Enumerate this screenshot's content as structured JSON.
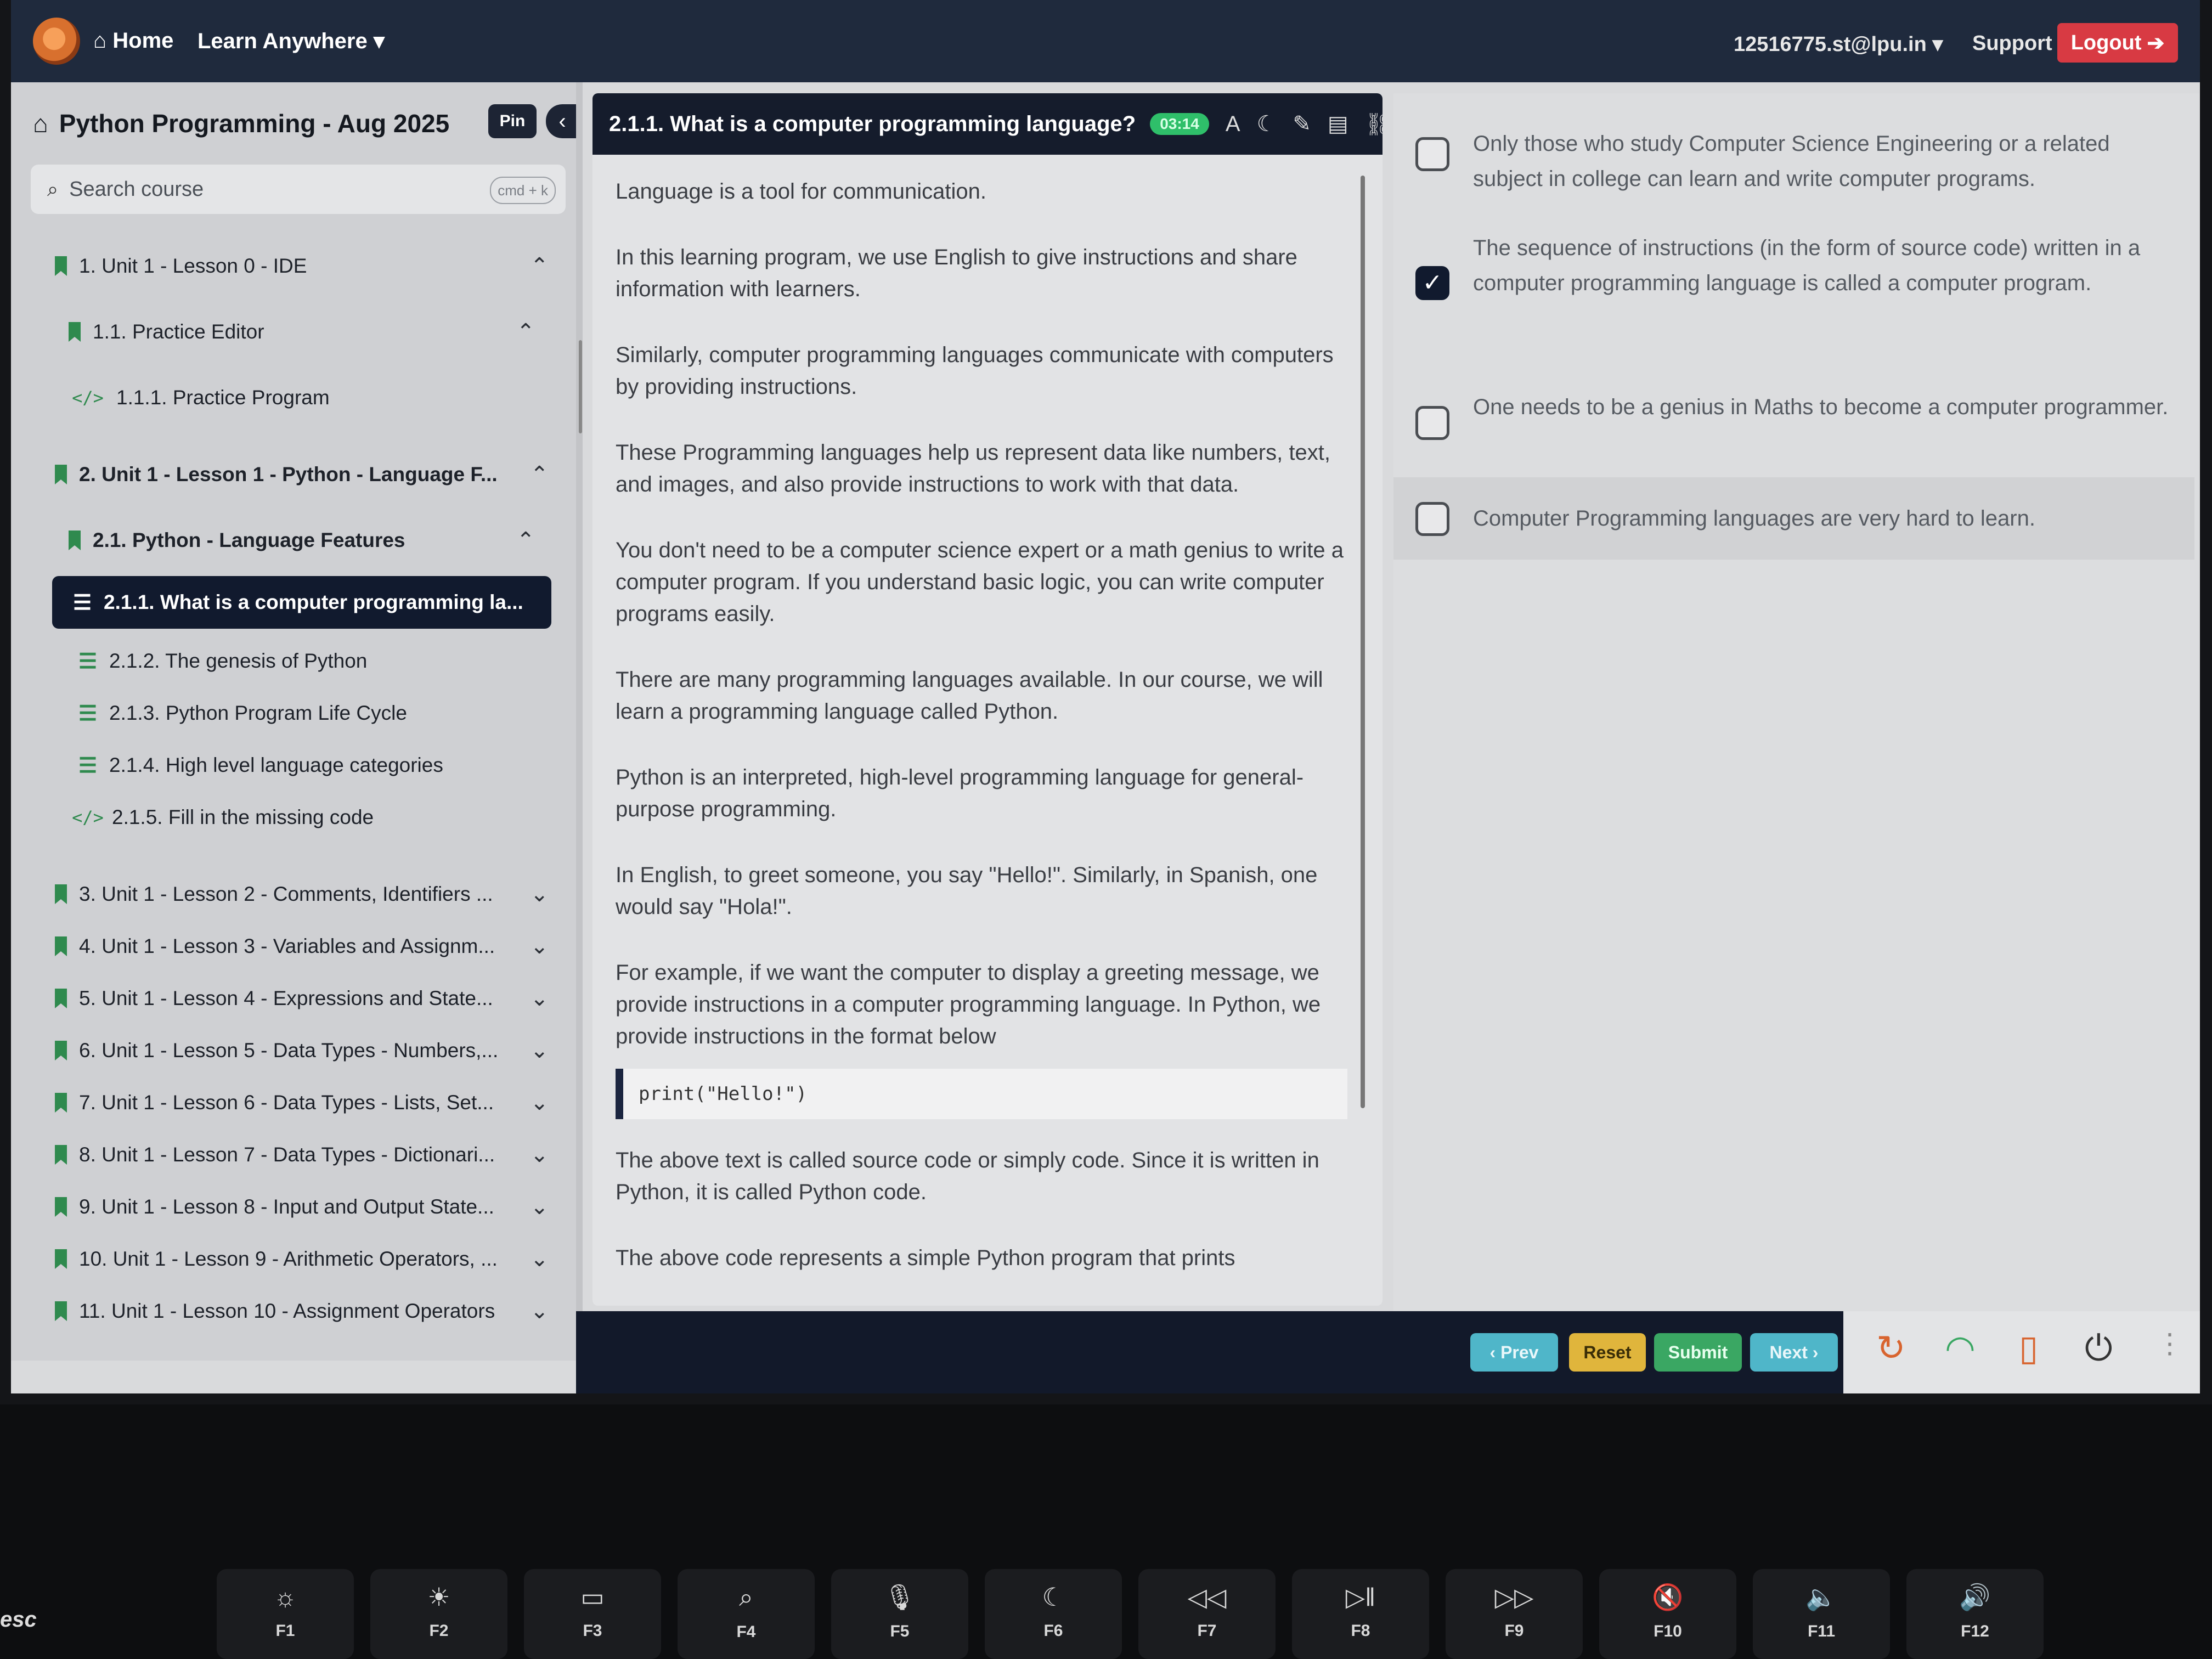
{
  "topnav": {
    "home_label": "Home",
    "learn_label": "Learn Anywhere",
    "user_label": "12516775.st@lpu.in",
    "support_label": "Support",
    "logout_label": "Logout"
  },
  "sidebar": {
    "course_title": "Python Programming - Aug 2025",
    "pin_label": "Pin",
    "search_placeholder": "Search course",
    "search_shortcut": "cmd + k",
    "items": [
      {
        "label": "1. Unit 1 - Lesson 0 - IDE"
      },
      {
        "label": "1.1. Practice Editor"
      },
      {
        "label": "1.1.1. Practice Program"
      },
      {
        "label": "2. Unit 1 - Lesson 1 - Python - Language F..."
      },
      {
        "label": "2.1. Python - Language Features"
      },
      {
        "label": "2.1.1. What is a computer programming la..."
      },
      {
        "label": "2.1.2. The genesis of Python"
      },
      {
        "label": "2.1.3. Python Program Life Cycle"
      },
      {
        "label": "2.1.4. High level language categories"
      },
      {
        "label": "2.1.5. Fill in the missing code"
      },
      {
        "label": "3. Unit 1 - Lesson 2 - Comments, Identifiers ..."
      },
      {
        "label": "4. Unit 1 - Lesson 3 - Variables and Assignm..."
      },
      {
        "label": "5. Unit 1 - Lesson 4 - Expressions and State..."
      },
      {
        "label": "6. Unit 1 - Lesson 5 - Data Types - Numbers,..."
      },
      {
        "label": "7. Unit 1 - Lesson 6 - Data Types - Lists, Set..."
      },
      {
        "label": "8. Unit 1 - Lesson 7 - Data Types - Dictionari..."
      },
      {
        "label": "9. Unit 1 - Lesson 8 - Input and Output State..."
      },
      {
        "label": "10. Unit 1 - Lesson 9 - Arithmetic Operators, ..."
      },
      {
        "label": "11. Unit 1 - Lesson 10 - Assignment Operators"
      }
    ]
  },
  "content": {
    "title": "2.1.1. What is a computer programming language?",
    "timer": "03:14",
    "paragraphs": [
      "Language is a tool for communication.",
      "In this learning program, we use English to give instructions and share information with learners.",
      "Similarly, computer programming languages communicate with computers by providing instructions.",
      "These Programming languages help us represent data like numbers, text, and images, and also provide instructions to work with that data.",
      "You don't need to be a computer science expert or a math genius to write a computer program. If you understand basic logic, you can write computer programs easily.",
      "There are many programming languages available. In our course, we will learn a programming language called Python.",
      "Python is an interpreted, high-level programming language for general-purpose programming.",
      "In English, to greet someone, you say \"Hello!\". Similarly, in Spanish, one would say \"Hola!\".",
      "For example, if we want the computer to display a greeting message, we provide instructions in a computer programming language. In Python, we provide instructions in the format below"
    ],
    "code": "print(\"Hello!\")",
    "after_code": [
      "The above text is called source code or simply code. Since it is written in Python, it is called Python code.",
      "The above code represents a simple Python program that prints"
    ]
  },
  "answers": {
    "options": [
      {
        "text": "Only those who study Computer Science Engineering or a related subject in college can learn and write computer programs.",
        "checked": false
      },
      {
        "text": "The sequence of instructions (in the form of source code) written in a computer programming language is called a computer program.",
        "checked": true
      },
      {
        "text": "One needs to be a genius in Maths to become a computer programmer.",
        "checked": false
      },
      {
        "text": "Computer Programming languages are very hard to learn.",
        "checked": false
      }
    ]
  },
  "bottom": {
    "prev_label": "‹ Prev",
    "reset_label": "Reset",
    "submit_label": "Submit",
    "next_label": "Next ›"
  },
  "keyboard": {
    "esc": "esc",
    "keys": [
      "F1",
      "F2",
      "F3",
      "F4",
      "F5",
      "F6",
      "F7",
      "F8",
      "F9",
      "F10",
      "F11",
      "F12"
    ]
  },
  "colors": {
    "nav_bg": "#1f2a3d",
    "accent_green": "#2f8a4e",
    "logout_red": "#d83a43",
    "active_item_bg": "#111a2e"
  }
}
